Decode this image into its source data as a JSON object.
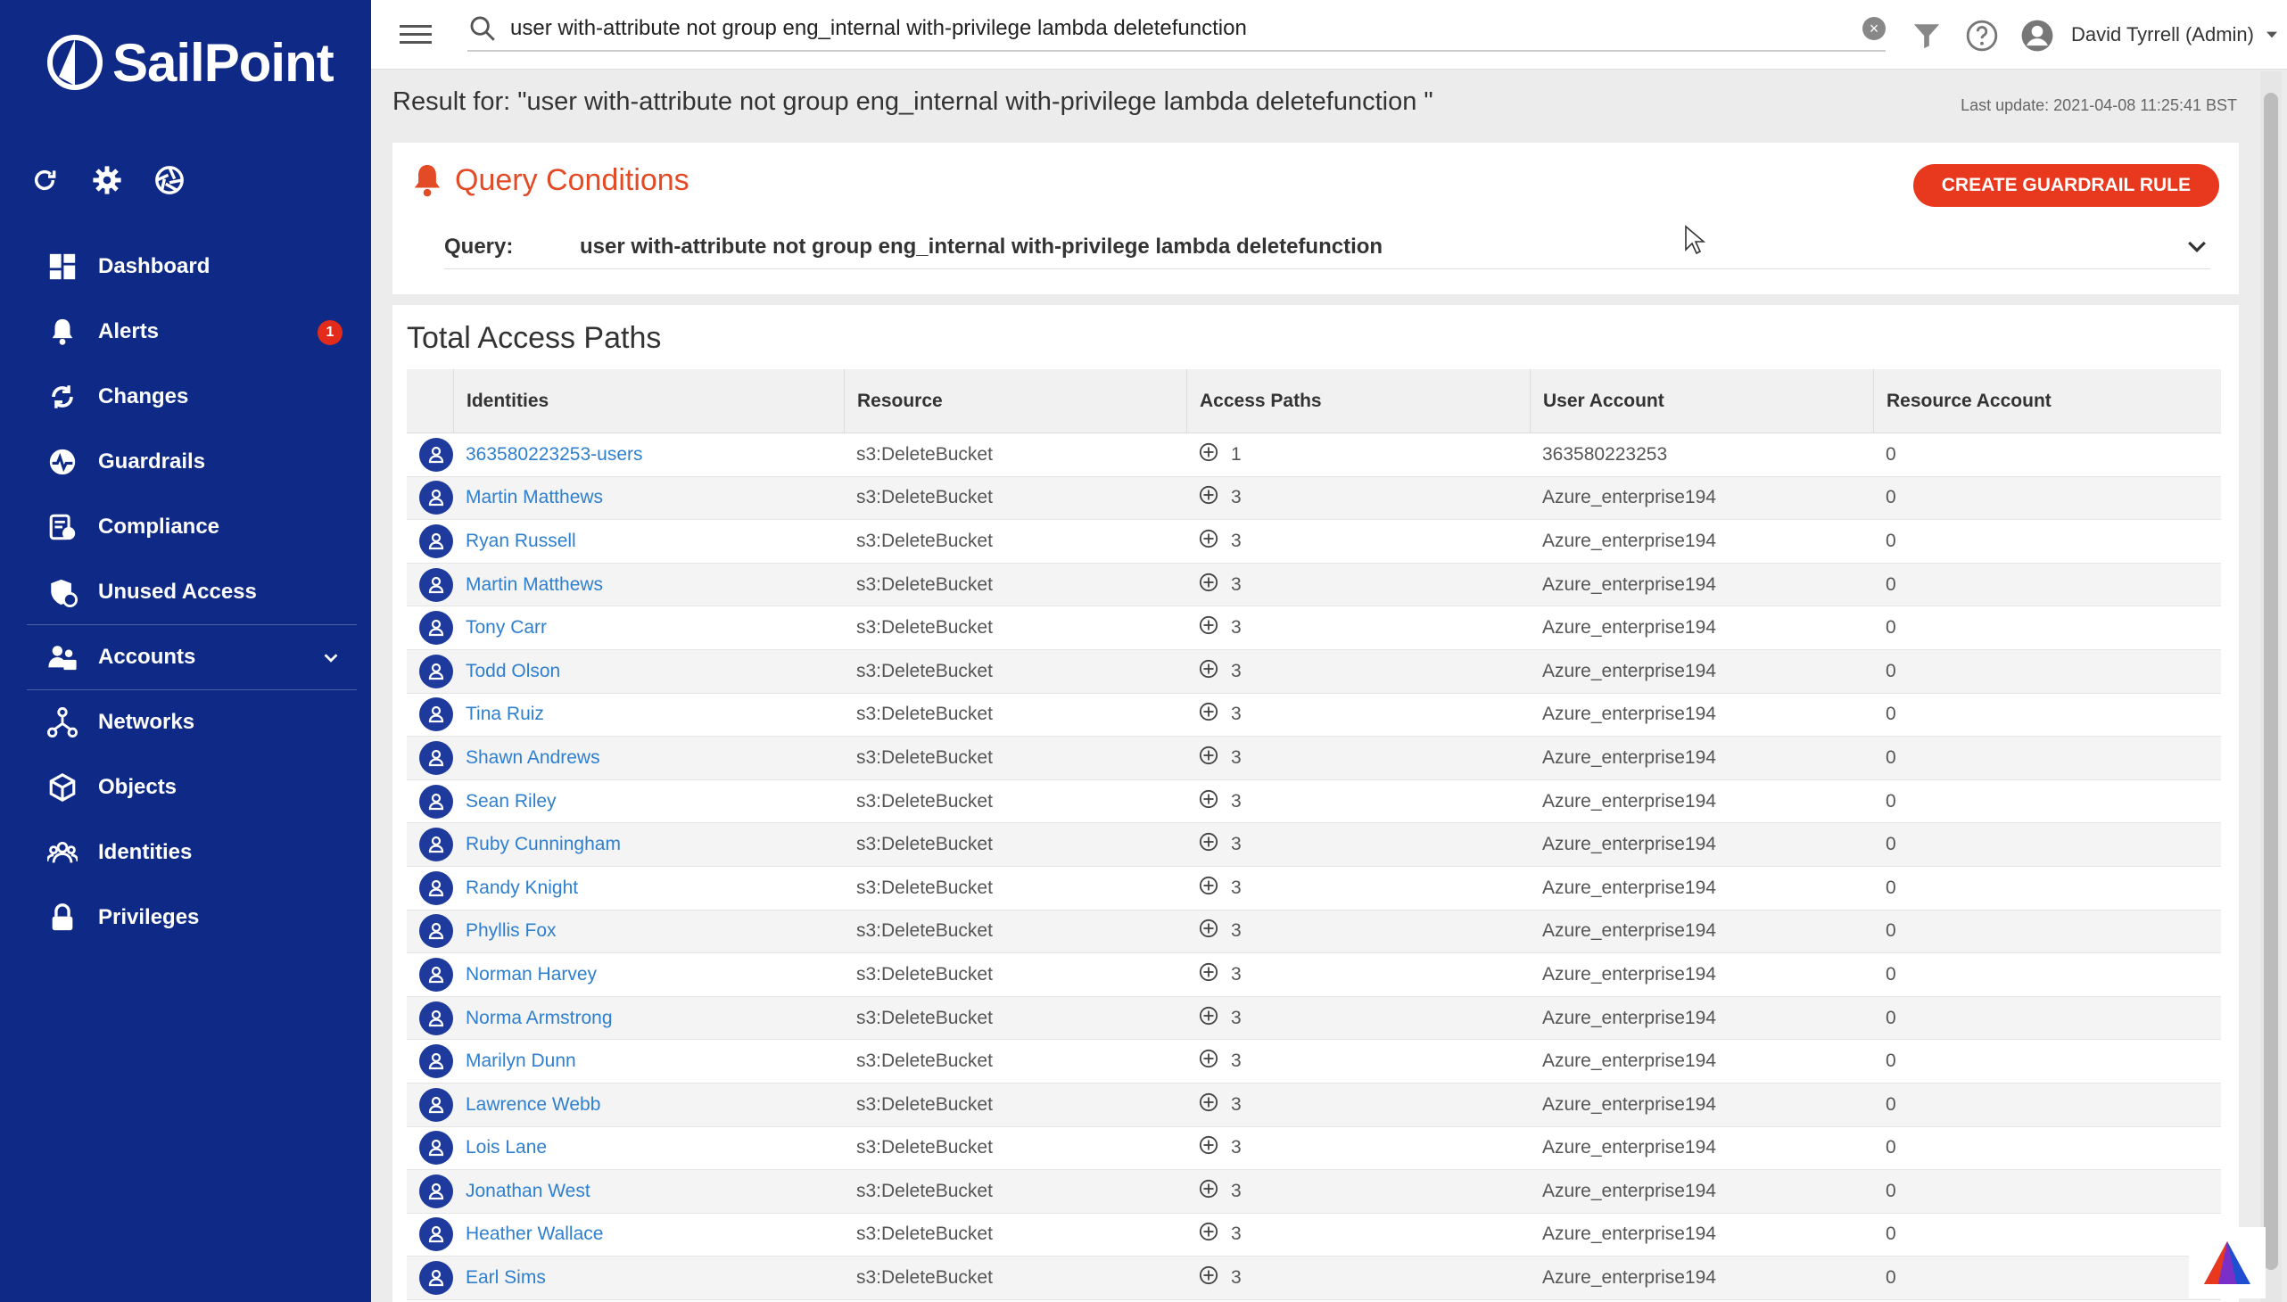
{
  "brand": {
    "name": "SailPoint"
  },
  "sidebar": {
    "items": [
      {
        "label": "Dashboard",
        "icon": "dashboard-icon"
      },
      {
        "label": "Alerts",
        "icon": "bell-icon",
        "badge": "1"
      },
      {
        "label": "Changes",
        "icon": "changes-icon"
      },
      {
        "label": "Guardrails",
        "icon": "guardrails-icon"
      },
      {
        "label": "Compliance",
        "icon": "compliance-icon"
      },
      {
        "label": "Unused Access",
        "icon": "unused-access-icon"
      },
      {
        "label": "Accounts",
        "icon": "accounts-icon"
      },
      {
        "label": "Networks",
        "icon": "networks-icon"
      },
      {
        "label": "Objects",
        "icon": "objects-icon"
      },
      {
        "label": "Identities",
        "icon": "identities-icon"
      },
      {
        "label": "Privileges",
        "icon": "lock-icon"
      }
    ]
  },
  "search": {
    "value": "user with-attribute not group eng_internal with-privilege lambda deletefunction"
  },
  "user": {
    "name": "David Tyrrell (Admin)"
  },
  "result": {
    "title": "Result for: \"user with-attribute not group eng_internal with-privilege lambda deletefunction \"",
    "last_update": "Last update: 2021-04-08 11:25:41 BST"
  },
  "query_conditions": {
    "title": "Query Conditions",
    "button": "CREATE GUARDRAIL RULE",
    "label": "Query:",
    "value": "user with-attribute not group eng_internal with-privilege lambda deletefunction"
  },
  "table": {
    "title": "Total Access Paths",
    "headers": [
      "Identities",
      "Resource",
      "Access Paths",
      "User Account",
      "Resource Account"
    ],
    "rows": [
      [
        "363580223253-users",
        "s3:DeleteBucket",
        "1",
        "363580223253",
        "0"
      ],
      [
        "Martin Matthews",
        "s3:DeleteBucket",
        "3",
        "Azure_enterprise194",
        "0"
      ],
      [
        "Ryan Russell",
        "s3:DeleteBucket",
        "3",
        "Azure_enterprise194",
        "0"
      ],
      [
        "Martin Matthews",
        "s3:DeleteBucket",
        "3",
        "Azure_enterprise194",
        "0"
      ],
      [
        "Tony Carr",
        "s3:DeleteBucket",
        "3",
        "Azure_enterprise194",
        "0"
      ],
      [
        "Todd Olson",
        "s3:DeleteBucket",
        "3",
        "Azure_enterprise194",
        "0"
      ],
      [
        "Tina Ruiz",
        "s3:DeleteBucket",
        "3",
        "Azure_enterprise194",
        "0"
      ],
      [
        "Shawn Andrews",
        "s3:DeleteBucket",
        "3",
        "Azure_enterprise194",
        "0"
      ],
      [
        "Sean Riley",
        "s3:DeleteBucket",
        "3",
        "Azure_enterprise194",
        "0"
      ],
      [
        "Ruby Cunningham",
        "s3:DeleteBucket",
        "3",
        "Azure_enterprise194",
        "0"
      ],
      [
        "Randy Knight",
        "s3:DeleteBucket",
        "3",
        "Azure_enterprise194",
        "0"
      ],
      [
        "Phyllis Fox",
        "s3:DeleteBucket",
        "3",
        "Azure_enterprise194",
        "0"
      ],
      [
        "Norman Harvey",
        "s3:DeleteBucket",
        "3",
        "Azure_enterprise194",
        "0"
      ],
      [
        "Norma Armstrong",
        "s3:DeleteBucket",
        "3",
        "Azure_enterprise194",
        "0"
      ],
      [
        "Marilyn Dunn",
        "s3:DeleteBucket",
        "3",
        "Azure_enterprise194",
        "0"
      ],
      [
        "Lawrence Webb",
        "s3:DeleteBucket",
        "3",
        "Azure_enterprise194",
        "0"
      ],
      [
        "Lois Lane",
        "s3:DeleteBucket",
        "3",
        "Azure_enterprise194",
        "0"
      ],
      [
        "Jonathan West",
        "s3:DeleteBucket",
        "3",
        "Azure_enterprise194",
        "0"
      ],
      [
        "Heather Wallace",
        "s3:DeleteBucket",
        "3",
        "Azure_enterprise194",
        "0"
      ],
      [
        "Earl Sims",
        "s3:DeleteBucket",
        "3",
        "Azure_enterprise194",
        "0"
      ]
    ]
  },
  "colors": {
    "sidebar": "#0f2a86",
    "accent": "#e8391f",
    "link": "#2f7fcf",
    "badge": "#e32b1c"
  }
}
